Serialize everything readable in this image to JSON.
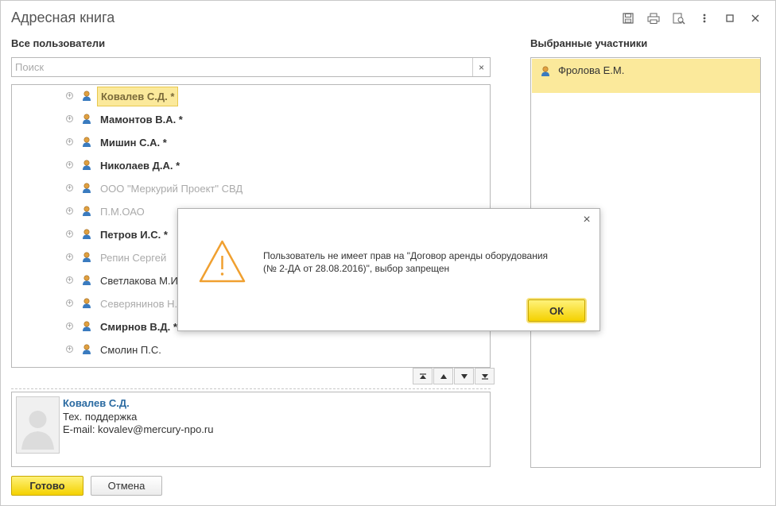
{
  "window": {
    "title": "Адресная книга",
    "icons": [
      "save-icon",
      "print-icon",
      "preview-icon",
      "more-icon",
      "maximize-icon",
      "close-icon"
    ]
  },
  "left": {
    "header": "Все пользователи",
    "search": {
      "placeholder": "Поиск",
      "value": "",
      "clear_label": "×"
    },
    "rows": [
      {
        "name": "Ковалев С.Д. *",
        "style": "selected"
      },
      {
        "name": "Мамонтов В.А. *",
        "style": "bold"
      },
      {
        "name": "Мишин С.А. *",
        "style": "bold"
      },
      {
        "name": "Николаев Д.А. *",
        "style": "bold"
      },
      {
        "name": "ООО \"Меркурий Проект\" СВД",
        "style": "grey"
      },
      {
        "name": "П.М.ОАО",
        "style": "grey"
      },
      {
        "name": "Петров И.С. *",
        "style": "bold"
      },
      {
        "name": "Репин Сергей",
        "style": "grey"
      },
      {
        "name": "Светлакова М.И.",
        "style": "normal"
      },
      {
        "name": "Северянинов Н.Н.",
        "style": "grey"
      },
      {
        "name": "Смирнов В.Д. *",
        "style": "bold"
      },
      {
        "name": "Смолин П.С.",
        "style": "normal"
      }
    ],
    "nav_icons": [
      "first-icon",
      "up-icon",
      "down-icon",
      "last-icon"
    ]
  },
  "card": {
    "name": "Ковалев С.Д.",
    "position": "Тех. поддержка",
    "email": "E-mail: kovalev@mercury-npo.ru"
  },
  "right": {
    "header": "Выбранные участники",
    "items": [
      {
        "name": "Фролова Е.М."
      }
    ]
  },
  "buttons": {
    "done": "Готово",
    "cancel": "Отмена"
  },
  "dialog": {
    "message_line1": "Пользователь не имеет прав на \"Договор аренды оборудования",
    "message_line2": "(№ 2-ДА от 28.08.2016)\", выбор запрещен",
    "ok": "ОК",
    "close": "×"
  },
  "colors": {
    "accent_yellow": "#f4d100",
    "selection": "#fbe99b",
    "link_blue": "#2a6aa1",
    "warning_orange": "#f0a030"
  }
}
